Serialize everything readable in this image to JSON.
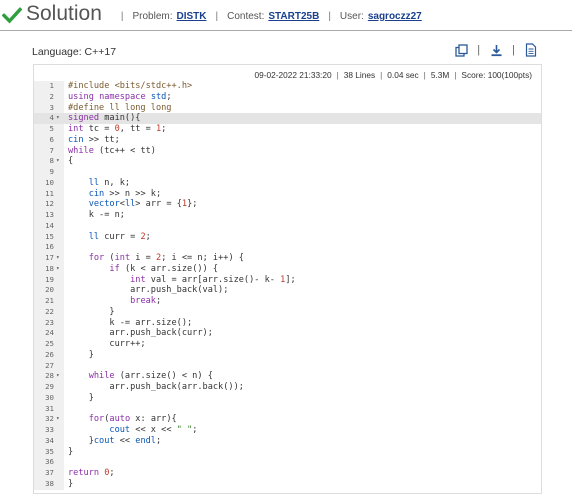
{
  "header": {
    "title": "Solution",
    "problem_label": "Problem:",
    "problem_code": "DISTK",
    "contest_label": "Contest:",
    "contest_code": "START25B",
    "user_label": "User:",
    "user_name": "sagroczz27",
    "separator": "|",
    "status_icon": "check-icon",
    "status_color": "#2e9e3e",
    "link_color": "#1a3f8f"
  },
  "toolbar": {
    "language": "Language: C++17",
    "icons": [
      "copy-icon",
      "download-icon",
      "file-icon"
    ]
  },
  "stats": {
    "datetime": "09-02-2022 21:33:20",
    "lines": "38 Lines",
    "time": "0.04 sec",
    "memory": "5.3M",
    "score": "Score: 100(100pts)"
  },
  "code": {
    "active_line": 4,
    "fold_lines": [
      4,
      8,
      17,
      18,
      28,
      32
    ],
    "lines": [
      "#include <bits/stdc++.h>",
      "using namespace std;",
      "#define ll long long",
      "signed main(){",
      "int tc = 0, tt = 1;",
      "cin >> tt;",
      "while (tc++ < tt)",
      "{",
      "",
      "    ll n, k;",
      "    cin >> n >> k;",
      "    vector<ll> arr = {1};",
      "    k -= n;",
      "",
      "    ll curr = 2;",
      "",
      "    for (int i = 2; i <= n; i++) {",
      "        if (k < arr.size()) {",
      "            int val = arr[arr.size()- k- 1];",
      "            arr.push_back(val);",
      "            break;",
      "        }",
      "        k -= arr.size();",
      "        arr.push_back(curr);",
      "        curr++;",
      "    }",
      "",
      "    while (arr.size() < n) {",
      "        arr.push_back(arr.back());",
      "    }",
      "",
      "    for(auto x: arr){",
      "        cout << x << \" \";",
      "    }cout << endl;",
      "}",
      "",
      "return 0;",
      "}"
    ]
  }
}
